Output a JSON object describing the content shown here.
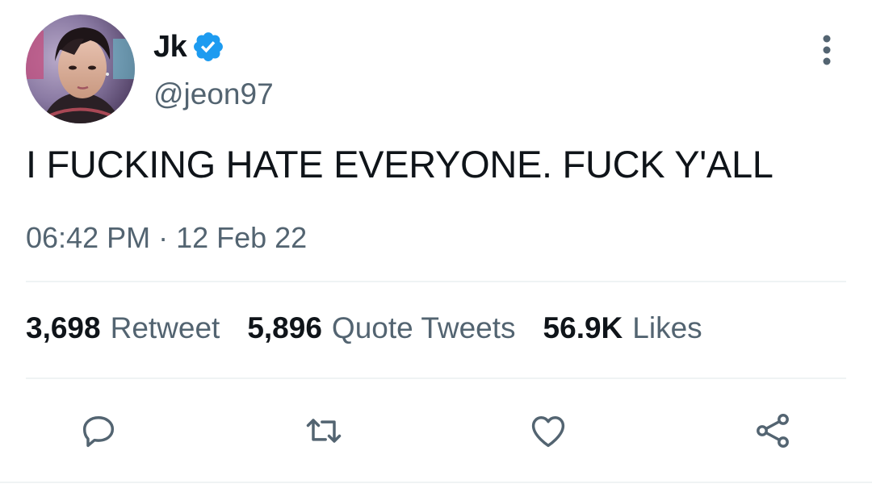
{
  "user": {
    "display_name": "Jk",
    "handle": "@jeon97",
    "verified": true,
    "avatar_icon": "profile-photo"
  },
  "tweet": {
    "text": "I FUCKING HATE EVERYONE. FUCK Y'ALL",
    "timestamp": "06:42 PM · 12 Feb 22"
  },
  "stats": {
    "retweets": {
      "count": "3,698",
      "label": "Retweet"
    },
    "quotes": {
      "count": "5,896",
      "label": "Quote Tweets"
    },
    "likes": {
      "count": "56.9K",
      "label": "Likes"
    }
  },
  "actions": [
    {
      "name": "reply",
      "icon": "reply-icon"
    },
    {
      "name": "retweet",
      "icon": "retweet-icon"
    },
    {
      "name": "like",
      "icon": "heart-icon"
    },
    {
      "name": "share",
      "icon": "share-icon"
    }
  ],
  "colors": {
    "text_primary": "#0f1419",
    "text_secondary": "#536471",
    "verified_blue": "#1d9bf0",
    "divider": "#eff3f4"
  }
}
